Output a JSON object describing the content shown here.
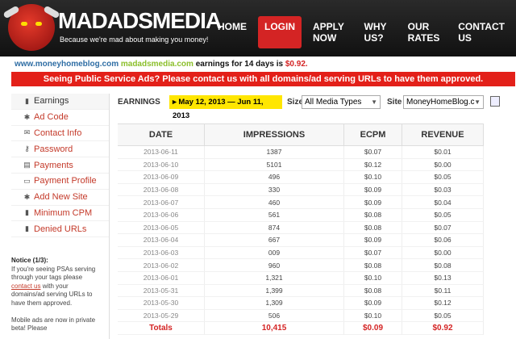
{
  "brand": {
    "name": "MADADSMEDIA",
    "tagline": "Because we're mad about making you money!"
  },
  "nav": [
    {
      "label": "HOME",
      "active": false
    },
    {
      "label": "LOGIN",
      "active": true
    },
    {
      "label": "APPLY NOW",
      "active": false
    },
    {
      "label": "WHY US?",
      "active": false
    },
    {
      "label": "OUR RATES",
      "active": false
    },
    {
      "label": "CONTACT US",
      "active": false
    }
  ],
  "stats": {
    "site": "www.moneyhomeblog.com",
    "brand": "madadsmedia.com",
    "text": "earnings for 14 days is",
    "amount": "$0.92."
  },
  "psa_banner": "Seeing Public Service Ads? Please contact us with all domains/ad serving URLs to have them approved.",
  "sidebar": [
    {
      "label": "Earnings",
      "icon": "bar-chart-icon"
    },
    {
      "label": "Ad Code",
      "icon": "gear-icon"
    },
    {
      "label": "Contact Info",
      "icon": "envelope-icon"
    },
    {
      "label": "Password",
      "icon": "key-icon"
    },
    {
      "label": "Payments",
      "icon": "payment-icon"
    },
    {
      "label": "Payment Profile",
      "icon": "card-icon"
    },
    {
      "label": "Add New Site",
      "icon": "gear-icon"
    },
    {
      "label": "Minimum CPM",
      "icon": "bar-chart-icon"
    },
    {
      "label": "Denied URLs",
      "icon": "bar-chart-icon"
    }
  ],
  "notice": {
    "title": "Notice (1/3):",
    "line1": "If you're seeing PSAs serving through your tags please",
    "link": "contact us",
    "line2": "with your domains/ad serving URLs to have them approved.",
    "line3": "Mobile ads are now in private beta! Please"
  },
  "filters": {
    "heading": "EARNINGS",
    "date_range": "May 12, 2013 — Jun 11, 2013",
    "size_label": "Size",
    "size_value": "All Media Types",
    "site_label": "Site",
    "site_value": "MoneyHomeBlog.c"
  },
  "table": {
    "headers": [
      "DATE",
      "IMPRESSIONS",
      "ECPM",
      "REVENUE"
    ],
    "rows": [
      [
        "2013-06-11",
        "1387",
        "$0.07",
        "$0.01"
      ],
      [
        "2013-06-10",
        "5101",
        "$0.12",
        "$0.00"
      ],
      [
        "2013-06-09",
        "496",
        "$0.10",
        "$0.05"
      ],
      [
        "2013-06-08",
        "330",
        "$0.09",
        "$0.03"
      ],
      [
        "2013-06-07",
        "460",
        "$0.09",
        "$0.04"
      ],
      [
        "2013-06-06",
        "561",
        "$0.08",
        "$0.05"
      ],
      [
        "2013-06-05",
        "874",
        "$0.08",
        "$0.07"
      ],
      [
        "2013-06-04",
        "667",
        "$0.09",
        "$0.06"
      ],
      [
        "2013-06-03",
        "009",
        "$0.07",
        "$0.00"
      ],
      [
        "2013-06-02",
        "960",
        "$0.08",
        "$0.08"
      ],
      [
        "2013-06-01",
        "1,321",
        "$0.10",
        "$0.13"
      ],
      [
        "2013-05-31",
        "1,399",
        "$0.08",
        "$0.11"
      ],
      [
        "2013-05-30",
        "1,309",
        "$0.09",
        "$0.12"
      ],
      [
        "2013-05-29",
        "506",
        "$0.10",
        "$0.05"
      ]
    ],
    "totals": [
      "Totals",
      "10,415",
      "$0.09",
      "$0.92"
    ]
  }
}
